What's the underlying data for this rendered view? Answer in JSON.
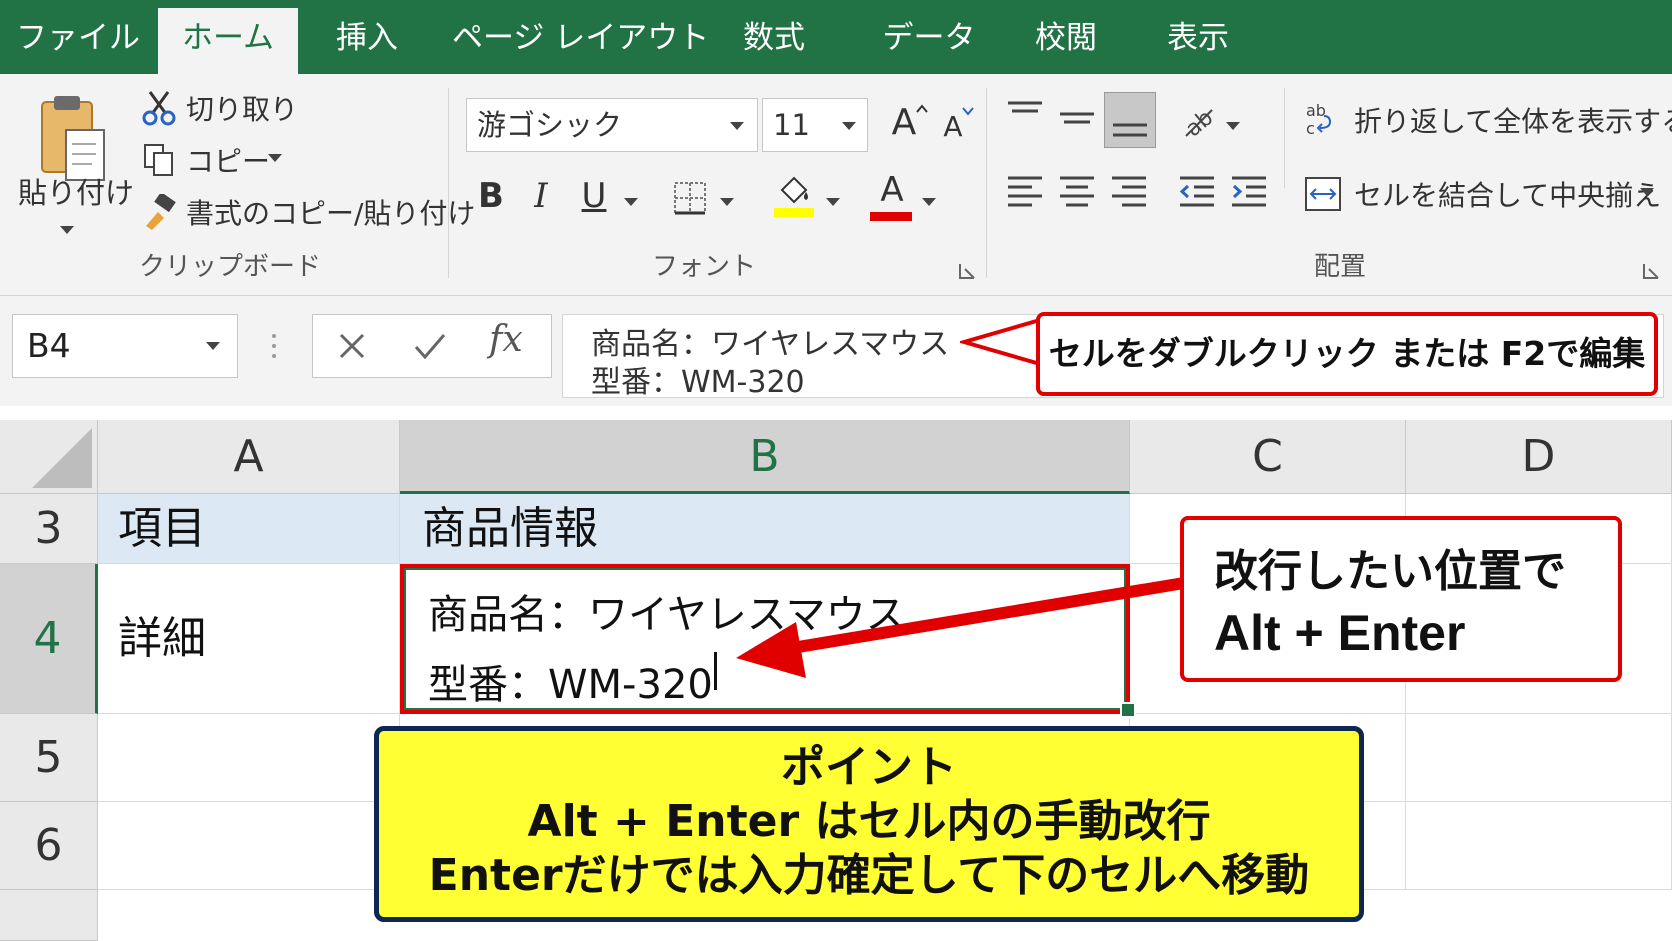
{
  "tabs": [
    {
      "label": "ファイル",
      "active": false
    },
    {
      "label": "ホーム",
      "active": true
    },
    {
      "label": "挿入",
      "active": false
    },
    {
      "label": "ページ レイアウト",
      "active": false
    },
    {
      "label": "数式",
      "active": false
    },
    {
      "label": "データ",
      "active": false
    },
    {
      "label": "校閲",
      "active": false
    },
    {
      "label": "表示",
      "active": false
    }
  ],
  "clipboard": {
    "paste_label": "貼り付け",
    "cut_label": "切り取り",
    "copy_label": "コピー",
    "format_painter_label": "書式のコピー/貼り付け",
    "group_label": "クリップボード"
  },
  "font": {
    "font_name": "游ゴシック",
    "font_size": "11",
    "grow_label": "A",
    "shrink_label": "A",
    "bold_label": "B",
    "italic_label": "I",
    "underline_label": "U",
    "font_color_label": "A",
    "group_label": "フォント",
    "highlight_color": "#ffff00",
    "font_color": "#e00000"
  },
  "alignment": {
    "wrap_text_label": "折り返して全体を表示する",
    "merge_center_label": "セルを結合して中央揃え",
    "wrap_icon_text": "ab c",
    "group_label": "配置"
  },
  "formula_bar": {
    "name_box": "B4",
    "fx_label": "fx",
    "content_lines": [
      "商品名：ワイヤレスマウス",
      "型番：WM-320"
    ],
    "callout": "セルをダブルクリック または F2で編集"
  },
  "grid": {
    "columns": [
      "A",
      "B",
      "C",
      "D"
    ],
    "selected_column": "B",
    "rows": [
      {
        "number": "3",
        "a": "項目",
        "b": "商品情報"
      },
      {
        "number": "4",
        "a": "詳細",
        "b_lines": [
          "商品名：ワイヤレスマウス",
          "型番：WM-320"
        ]
      },
      {
        "number": "5"
      },
      {
        "number": "6"
      }
    ],
    "selected_row": "4"
  },
  "callouts": {
    "alt_enter_line1": "改行したい位置で",
    "alt_enter_line2": "Alt + Enter",
    "point_title": "ポイント",
    "point_line1": "Alt + Enter はセル内の手動改行",
    "point_line2": "Enterだけでは入力確定して下のセルへ移動"
  },
  "colors": {
    "excel_green": "#217346",
    "callout_red": "#e00000",
    "note_yellow": "#ffff33",
    "note_border": "#0d2750",
    "header_fill": "#dde8f5"
  }
}
